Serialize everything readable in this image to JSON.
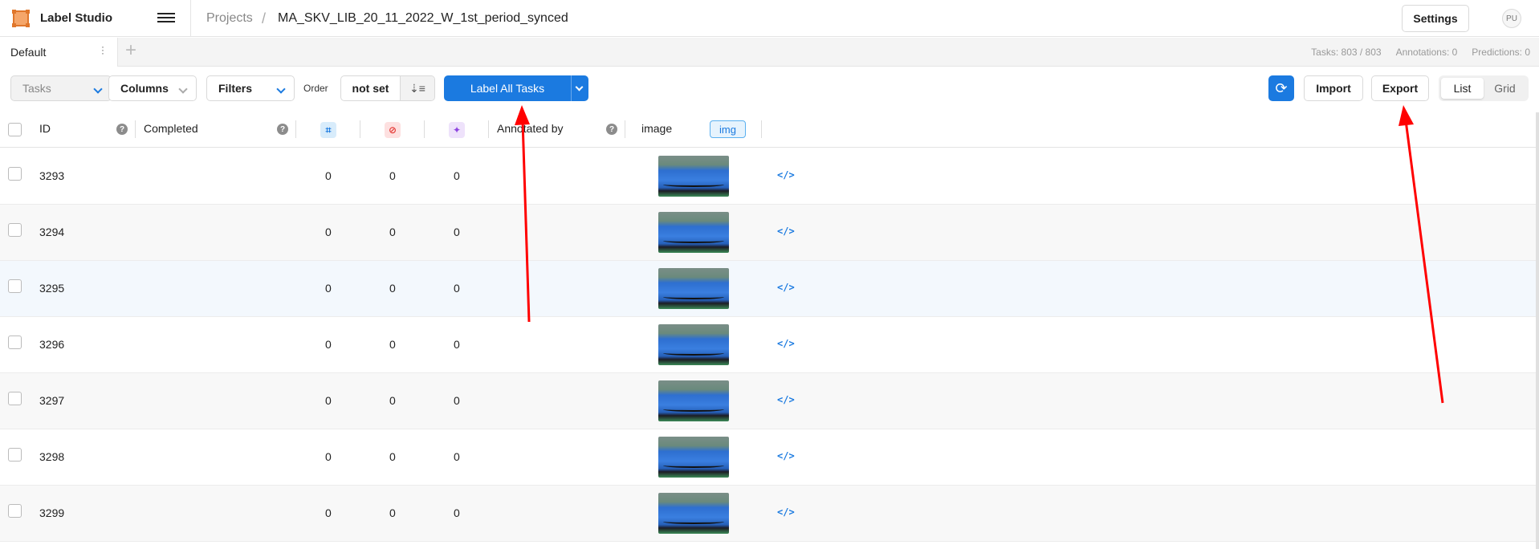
{
  "app": {
    "name": "Label Studio",
    "avatar_initials": "PU"
  },
  "breadcrumb": {
    "projects": "Projects",
    "separator": "/",
    "project": "MA_SKV_LIB_20_11_2022_W_1st_period_synced"
  },
  "header": {
    "settings": "Settings"
  },
  "tabs": {
    "active": "Default",
    "add": "+"
  },
  "stats": {
    "tasks": "Tasks: 803 / 803",
    "annotations": "Annotations: 0",
    "predictions": "Predictions: 0"
  },
  "toolbar": {
    "tasks": "Tasks",
    "columns": "Columns",
    "filters": "Filters",
    "order_label": "Order",
    "order_value": "not set",
    "label_all": "Label All Tasks",
    "import": "Import",
    "export": "Export",
    "view_list": "List",
    "view_grid": "Grid"
  },
  "columns": {
    "id": "ID",
    "completed": "Completed",
    "annotated_by": "Annotated by",
    "image": "image",
    "image_badge": "img"
  },
  "rows": [
    {
      "id": "3293",
      "total": "0",
      "cancelled": "0",
      "predictions": "0"
    },
    {
      "id": "3294",
      "total": "0",
      "cancelled": "0",
      "predictions": "0"
    },
    {
      "id": "3295",
      "total": "0",
      "cancelled": "0",
      "predictions": "0"
    },
    {
      "id": "3296",
      "total": "0",
      "cancelled": "0",
      "predictions": "0"
    },
    {
      "id": "3297",
      "total": "0",
      "cancelled": "0",
      "predictions": "0"
    },
    {
      "id": "3298",
      "total": "0",
      "cancelled": "0",
      "predictions": "0"
    },
    {
      "id": "3299",
      "total": "0",
      "cancelled": "0",
      "predictions": "0"
    }
  ],
  "colors": {
    "accent": "#1b7ae0",
    "annotation_arrow": "#ff0000"
  }
}
